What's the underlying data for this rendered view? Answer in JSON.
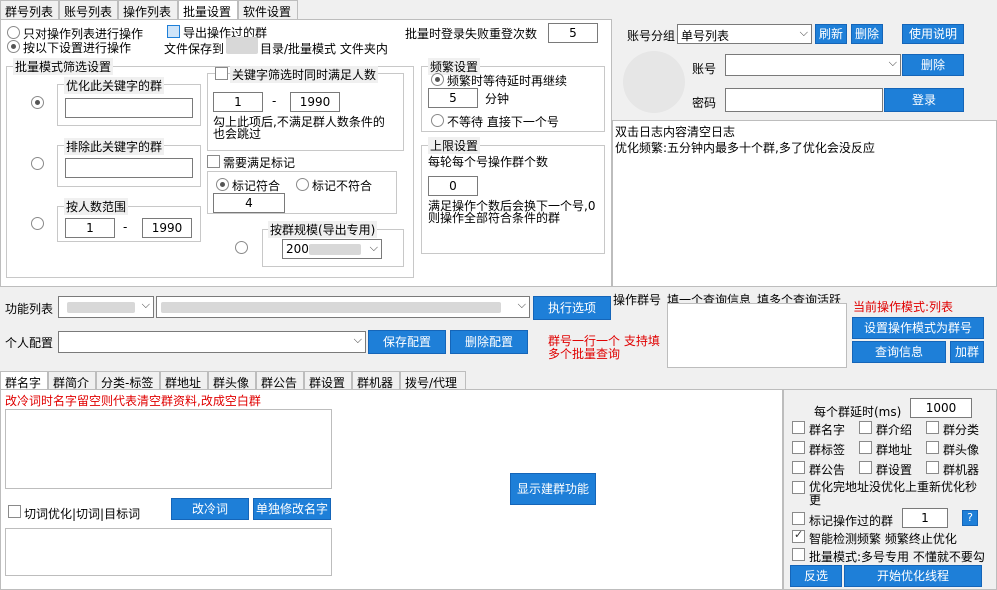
{
  "top_tabs": [
    "群号列表",
    "账号列表",
    "操作列表",
    "批量设置",
    "软件设置"
  ],
  "mode": {
    "only_list": "只对操作列表进行操作",
    "by_settings": "按以下设置进行操作"
  },
  "export": {
    "label": "导出操作过的群",
    "save_to": "文件保存到",
    "save_to_rest": "目录/批量模式 文件夹内"
  },
  "relogin": {
    "label": "批量时登录失败重登次数",
    "value": "5"
  },
  "filter": {
    "title": "批量模式筛选设置",
    "prefer_kw": "优化此关键字的群",
    "exclude_kw": "排除此关键字的群",
    "member_range": "按人数范围",
    "range_min": "1",
    "range_max": "1990",
    "kw_also_member": "关键字筛选时同时满足人数",
    "kw_min": "1",
    "kw_max": "1990",
    "kw_note": "勾上此项后,不满足群人数条件的也会跳过",
    "need_mark": "需要满足标记",
    "mark_match": "标记符合",
    "mark_not_match": "标记不符合",
    "mark_value": "4",
    "by_scale": "按群规模(导出专用)",
    "scale_value": "200"
  },
  "freq": {
    "title": "频繁设置",
    "wait_continue": "频繁时等待延时再继续",
    "minutes": "5",
    "minutes_unit": "分钟",
    "no_wait": "不等待 直接下一个号"
  },
  "limit": {
    "title": "上限设置",
    "per_account": "每轮每个号操作群个数",
    "value": "0",
    "note": "满足操作个数后会换下一个号,0则操作全部符合条件的群"
  },
  "account": {
    "group_label": "账号分组",
    "group_value": "单号列表",
    "refresh": "刷新",
    "delete": "删除",
    "help": "使用说明",
    "acct_label": "账号",
    "delete2": "删除",
    "pwd_label": "密码",
    "login": "登录"
  },
  "log": {
    "line1": "双击日志内容清空日志",
    "line2": "优化频繁:五分钟内最多十个群,多了优化会没反应"
  },
  "func": {
    "label": "功能列表",
    "exec": "执行选项",
    "profile_label": "个人配置",
    "save_cfg": "保存配置",
    "delete_cfg": "删除配置",
    "note": "群号一行一个 支持填多个批量查询"
  },
  "query": {
    "col1": "操作群号",
    "col2": "填一个查询信息",
    "col3": "填多个查询活跃",
    "mode_text": "当前操作模式:列表",
    "set_mode": "设置操作模式为群号",
    "query_info": "查询信息",
    "add_group": "加群"
  },
  "bottom_tabs": [
    "群名字",
    "群简介",
    "分类-标签",
    "群地址",
    "群头像",
    "群公告",
    "群设置",
    "群机器",
    "拨号/代理"
  ],
  "bottom": {
    "hint": "改冷词时名字留空则代表清空群资料,改成空白群",
    "cut_word": "切词优化|切词|目标词",
    "change_word": "改冷词",
    "rename": "单独修改名字",
    "show_build": "显示建群功能"
  },
  "right": {
    "delay_label": "每个群延时(ms)",
    "delay_value": "1000",
    "checks": [
      "群名字",
      "群介绍",
      "群分类",
      "群标签",
      "群地址",
      "群头像",
      "群公告",
      "群设置",
      "群机器"
    ],
    "reoptimize": "优化完地址没优化上重新优化秒更",
    "mark_done": "标记操作过的群",
    "mark_value": "1",
    "help_q": "?",
    "smart_freq": "智能检测频繁 频繁终止优化",
    "batch_mode": "批量模式:多号专用 不懂就不要勾",
    "invert": "反选",
    "start": "开始优化线程"
  }
}
